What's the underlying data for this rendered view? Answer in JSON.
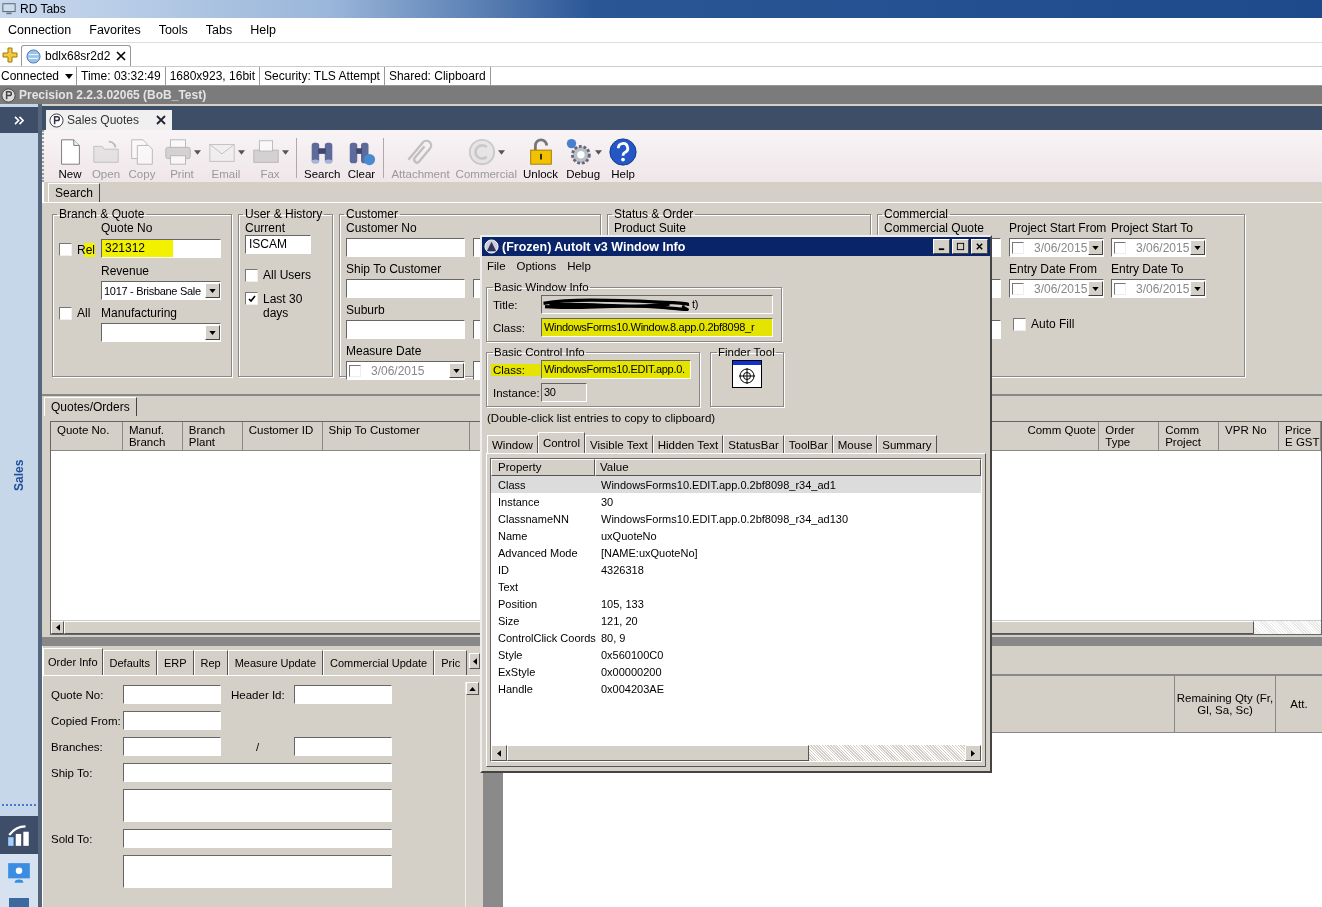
{
  "window": {
    "title": "RD Tabs"
  },
  "menu": [
    "Connection",
    "Favorites",
    "Tools",
    "Tabs",
    "Help"
  ],
  "session_tabs": [
    {
      "label": "bdlx68sr2d2",
      "selected": true
    }
  ],
  "connection_bar": {
    "state": "Connected",
    "items": [
      "Time: 03:32:49",
      "1680x923, 16bit",
      "Security: TLS Attempt",
      "Shared: Clipboard"
    ]
  },
  "app": {
    "title": "Precision 2.2.3.02065 (BoB_Test)",
    "sidebar_label": "Sales",
    "doc_tabs": [
      {
        "label": "Sales Quotes",
        "selected": true
      }
    ],
    "toolbar": [
      {
        "label": "New",
        "disabled": false,
        "dropdown": false,
        "separator": false
      },
      {
        "label": "Open",
        "disabled": true,
        "dropdown": false,
        "separator": false
      },
      {
        "label": "Copy",
        "disabled": true,
        "dropdown": false,
        "separator": false
      },
      {
        "label": "Print",
        "disabled": true,
        "dropdown": true,
        "separator": false
      },
      {
        "label": "Email",
        "disabled": true,
        "dropdown": true,
        "separator": false
      },
      {
        "label": "Fax",
        "disabled": true,
        "dropdown": true,
        "separator": true
      },
      {
        "label": "Search",
        "disabled": false,
        "dropdown": false,
        "separator": false
      },
      {
        "label": "Clear",
        "disabled": false,
        "dropdown": false,
        "separator": true
      },
      {
        "label": "Attachment",
        "disabled": true,
        "dropdown": false,
        "separator": false
      },
      {
        "label": "Commercial",
        "disabled": true,
        "dropdown": true,
        "separator": false
      },
      {
        "label": "Unlock",
        "disabled": false,
        "dropdown": false,
        "separator": false
      },
      {
        "label": "Debug",
        "disabled": false,
        "dropdown": true,
        "separator": false
      },
      {
        "label": "Help",
        "disabled": false,
        "dropdown": false,
        "separator": false
      }
    ],
    "search_tabs": [
      {
        "label": "Search",
        "selected": true
      }
    ],
    "branch_quote": {
      "title": "Branch & Quote",
      "quote_no_label": "Quote No",
      "rel": {
        "label": "Rel",
        "checked": false
      },
      "quote_no": {
        "value": "321312",
        "highlighted": true
      },
      "revenue_label": "Revenue",
      "revenue": "1017 - Brisbane Sale",
      "all": {
        "label": "All",
        "checked": false
      },
      "manufacturing_label": "Manufacturing"
    },
    "user_history": {
      "title": "User & History",
      "current_label": "Current",
      "current": "ISCAM",
      "all_users": {
        "label": "All Users",
        "checked": false
      },
      "last_30": {
        "label": "Last 30 days",
        "checked": true
      }
    },
    "customer": {
      "title": "Customer",
      "customer_no_label": "Customer No",
      "ship_to_label": "Ship To Customer",
      "suburb_label": "Suburb",
      "measure_date_label": "Measure Date",
      "measure_date": {
        "value": "3/06/2015",
        "checked": false
      }
    },
    "status_order": {
      "title": "Status & Order",
      "product_suite_label": "Product Suite"
    },
    "commercial": {
      "title": "Commercial",
      "commercial_quote_label": "Commercial Quote",
      "dates": [
        {
          "label": "Project Start From",
          "value": "3/06/2015",
          "checked": false
        },
        {
          "label": "Project Start To",
          "value": "3/06/2015",
          "checked": false
        },
        {
          "label": "Entry Date From",
          "value": "3/06/2015",
          "checked": false
        },
        {
          "label": "Entry Date To",
          "value": "3/06/2015",
          "checked": false
        }
      ],
      "auto_fill": {
        "label": "Auto Fill",
        "checked": false
      }
    },
    "results_tabs": [
      {
        "label": "Quotes/Orders",
        "selected": true
      }
    ],
    "grid_columns_left": [
      "Quote No.",
      "Manuf. Branch",
      "Branch Plant",
      "Customer ID",
      "Ship To Customer"
    ],
    "grid_columns_right": [
      "Comm Quote",
      "Order Type",
      "Comm Project",
      "VPR No",
      "Price E GST"
    ],
    "detail_tabs": [
      {
        "label": "Order Info",
        "selected": true
      },
      {
        "label": "Defaults",
        "selected": false
      },
      {
        "label": "ERP",
        "selected": false
      },
      {
        "label": "Rep",
        "selected": false
      },
      {
        "label": "Measure Update",
        "selected": false
      },
      {
        "label": "Commercial Update",
        "selected": false
      },
      {
        "label": "Pric",
        "selected": false
      }
    ],
    "order_form": {
      "quote_no_label": "Quote No:",
      "header_id_label": "Header Id:",
      "copied_from_label": "Copied From:",
      "branches_label": "Branches:",
      "branches_separator": "/",
      "ship_to_label": "Ship To:",
      "sold_to_label": "Sold To:"
    },
    "lines_columns": [
      "Remaining Qty (Fr, Gl, Sa, Sc)",
      "Att."
    ]
  },
  "dialog": {
    "title": "(Frozen) AutoIt v3 Window Info",
    "menu": [
      "File",
      "Options",
      "Help"
    ],
    "window_group": {
      "title": "Basic Window Info",
      "title_label": "Title:",
      "title_visible": "t)",
      "class_label": "Class:",
      "class_value": "WindowsForms10.Window.8.app.0.2bf8098_r",
      "class_highlighted": true
    },
    "control_group": {
      "title": "Basic Control Info",
      "class_label": "Class:",
      "class_value": "WindowsForms10.EDIT.app.0.",
      "class_highlighted": true,
      "instance_label": "Instance:",
      "instance_value": "30"
    },
    "finder_tool": {
      "title": "Finder Tool"
    },
    "note": "(Double-click list entries to copy to clipboard)",
    "tabs": [
      {
        "label": "Window",
        "selected": false
      },
      {
        "label": "Control",
        "selected": true
      },
      {
        "label": "Visible Text",
        "selected": false
      },
      {
        "label": "Hidden Text",
        "selected": false
      },
      {
        "label": "StatusBar",
        "selected": false
      },
      {
        "label": "ToolBar",
        "selected": false
      },
      {
        "label": "Mouse",
        "selected": false
      },
      {
        "label": "Summary",
        "selected": false
      }
    ],
    "columns": [
      "Property",
      "Value"
    ],
    "rows": [
      {
        "property": "Class",
        "value": "WindowsForms10.EDIT.app.0.2bf8098_r34_ad1",
        "selected": true
      },
      {
        "property": "Instance",
        "value": "30",
        "selected": false
      },
      {
        "property": "ClassnameNN",
        "value": "WindowsForms10.EDIT.app.0.2bf8098_r34_ad130",
        "selected": false
      },
      {
        "property": "Name",
        "value": "uxQuoteNo",
        "selected": false
      },
      {
        "property": "Advanced Mode",
        "value": "[NAME:uxQuoteNo]",
        "selected": false
      },
      {
        "property": "ID",
        "value": "4326318",
        "selected": false
      },
      {
        "property": "Text",
        "selected": false
      },
      {
        "property": "Position",
        "value": "105, 133",
        "selected": false
      },
      {
        "property": "Size",
        "value": "121, 20",
        "selected": false
      },
      {
        "property": "ControlClick Coords",
        "value": "80, 9",
        "selected": false
      },
      {
        "property": "Style",
        "value": "0x560100C0",
        "selected": false
      },
      {
        "property": "ExStyle",
        "value": "0x00000200",
        "selected": false
      },
      {
        "property": "Handle",
        "value": "0x004203AE",
        "selected": false
      }
    ]
  }
}
